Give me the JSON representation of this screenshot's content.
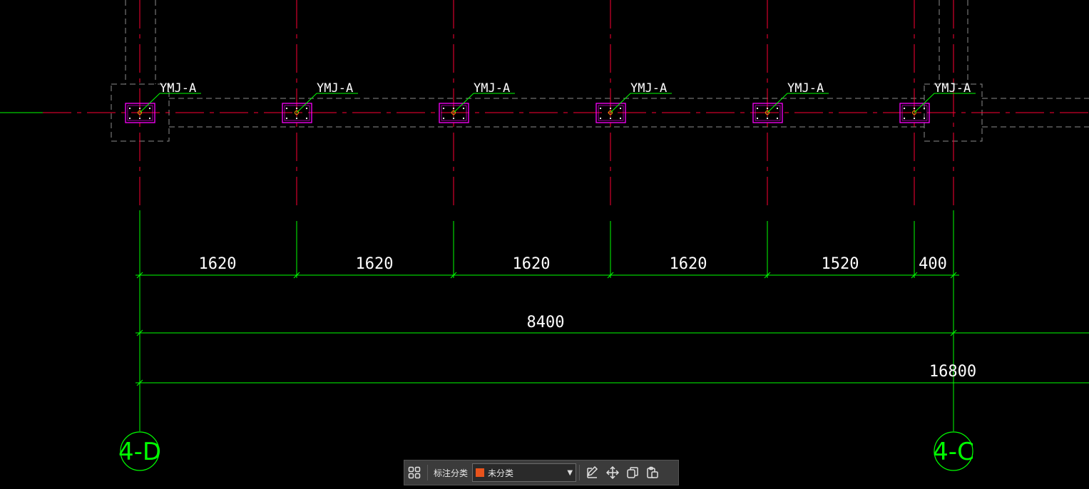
{
  "drawing": {
    "column_tag": "YMJ-A",
    "dimensions_row1": [
      "1620",
      "1620",
      "1620",
      "1620",
      "1520",
      "400"
    ],
    "dimension_row2": "8400",
    "dimension_row3": "16800",
    "axis_left": "4-D",
    "axis_right": "4-C",
    "colors": {
      "background": "#000000",
      "axis_line": "#ff0033",
      "dimension_line": "#00ff00",
      "column_box": "#ff00ff",
      "hidden_outline": "#8c8c8c",
      "text": "#ffffff"
    }
  },
  "toolbar": {
    "grid_icon": "grid-icon",
    "label": "标注分类",
    "select_value": "未分类",
    "select_color": "#e8531c",
    "icons": [
      "edit-icon",
      "move-icon",
      "copy-icon",
      "paste-icon"
    ]
  }
}
